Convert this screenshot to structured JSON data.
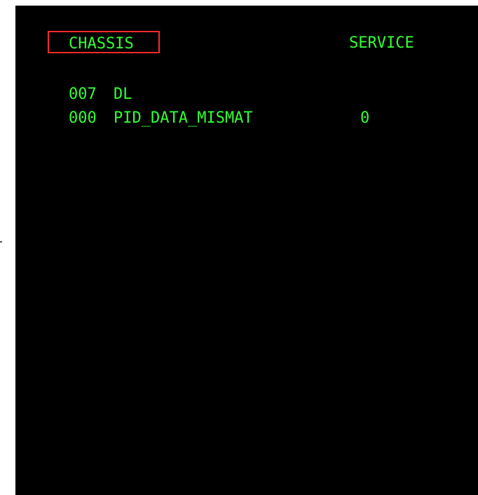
{
  "colors": {
    "screen_background": "#000000",
    "text": "#33ff33",
    "selection_border": "#ff2a2a",
    "page_background": "#ffffff"
  },
  "header": {
    "tab_chassis": "CHASSIS",
    "tab_service": "SERVICE",
    "selected_tab": "CHASSIS"
  },
  "rows": [
    {
      "code": "007",
      "label": "DL",
      "value": ""
    },
    {
      "code": "000",
      "label": "PID_DATA_MISMAT",
      "value": "0"
    }
  ]
}
